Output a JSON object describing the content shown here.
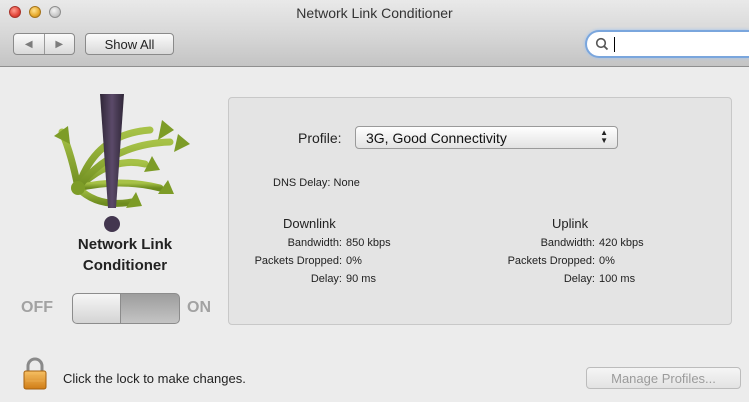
{
  "window": {
    "title": "Network Link Conditioner"
  },
  "toolbar": {
    "back_icon": "chevron-left-icon",
    "forward_icon": "chevron-right-icon",
    "show_all_label": "Show All",
    "search_value": ""
  },
  "app": {
    "name_line1": "Network Link",
    "name_line2": "Conditioner",
    "toggle_off_label": "OFF",
    "toggle_on_label": "ON",
    "toggle_state": "off"
  },
  "settings": {
    "profile_label": "Profile:",
    "profile_value": "3G, Good Connectivity",
    "dns_delay": "DNS Delay: None",
    "downlink": {
      "header": "Downlink",
      "bandwidth_label": "Bandwidth:",
      "bandwidth_value": "850 kbps",
      "packets_label": "Packets Dropped:",
      "packets_value": "0%",
      "delay_label": "Delay:",
      "delay_value": "90 ms"
    },
    "uplink": {
      "header": "Uplink",
      "bandwidth_label": "Bandwidth:",
      "bandwidth_value": "420 kbps",
      "packets_label": "Packets Dropped:",
      "packets_value": "0%",
      "delay_label": "Delay:",
      "delay_value": "100 ms"
    }
  },
  "footer": {
    "lock_text": "Click the lock to make changes.",
    "manage_profiles_label": "Manage Profiles..."
  },
  "colors": {
    "search_focus": "#7aa6dd",
    "logo_arrows": "#8aaa2e",
    "logo_mark": "#473a55",
    "lock_body": "#e59a2c"
  }
}
